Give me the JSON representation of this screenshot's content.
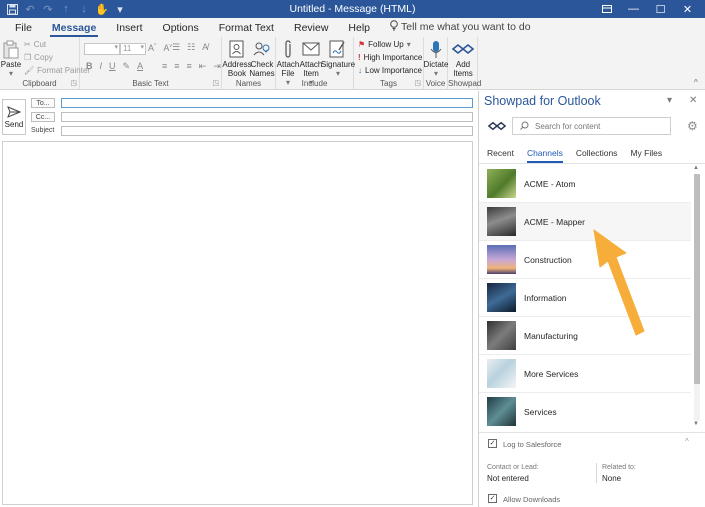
{
  "window": {
    "title": "Untitled  -  Message (HTML)",
    "qat_icons": [
      "save-icon",
      "undo-icon",
      "redo-icon",
      "up-arrow-icon",
      "down-arrow-icon",
      "touch-mode-icon",
      "customize-icon"
    ],
    "controls": [
      "ribbon-display-icon",
      "minimize-icon",
      "maximize-icon",
      "close-icon"
    ]
  },
  "ribbon_tabs": [
    {
      "label": "File"
    },
    {
      "label": "Message"
    },
    {
      "label": "Insert"
    },
    {
      "label": "Options"
    },
    {
      "label": "Format Text"
    },
    {
      "label": "Review"
    },
    {
      "label": "Help"
    }
  ],
  "tell_me": "Tell me what you want to do",
  "clipboard": {
    "paste": "Paste",
    "cut": "Cut",
    "copy": "Copy",
    "format_painter": "Format Painter",
    "label": "Clipboard"
  },
  "basic_text": {
    "font_size": "11",
    "label": "Basic Text"
  },
  "names": {
    "address_book": "Address Book",
    "check_names": "Check Names",
    "label": "Names"
  },
  "include": {
    "attach_file": "Attach File",
    "attach_item": "Attach Item",
    "signature": "Signature",
    "label": "Include"
  },
  "tags": {
    "follow_up": "Follow Up",
    "high": "High Importance",
    "low": "Low Importance",
    "label": "Tags"
  },
  "voice": {
    "dictate": "Dictate",
    "label": "Voice"
  },
  "showpad_group": {
    "add_items": "Add Items",
    "label": "Showpad"
  },
  "compose": {
    "send": "Send",
    "to": "To...",
    "cc": "Cc...",
    "subject": "Subject"
  },
  "pane": {
    "title": "Showpad for Outlook",
    "search_placeholder": "Search for content",
    "tabs": [
      "Recent",
      "Channels",
      "Collections",
      "My Files"
    ],
    "active_tab": "Channels",
    "channels": [
      {
        "label": "ACME - Atom"
      },
      {
        "label": "ACME - Mapper"
      },
      {
        "label": "Construction"
      },
      {
        "label": "Information"
      },
      {
        "label": "Manufacturing"
      },
      {
        "label": "More Services"
      },
      {
        "label": "Services"
      }
    ],
    "log_to_salesforce": "Log to Salesforce",
    "contact_label": "Contact or Lead:",
    "contact_value": "Not entered",
    "related_label": "Related to:",
    "related_value": "None",
    "allow_downloads": "Allow Downloads"
  },
  "colors": {
    "brand": "#2b579a",
    "accent_arrow": "#f6ad3a",
    "active_tab": "#1f5bb6"
  }
}
